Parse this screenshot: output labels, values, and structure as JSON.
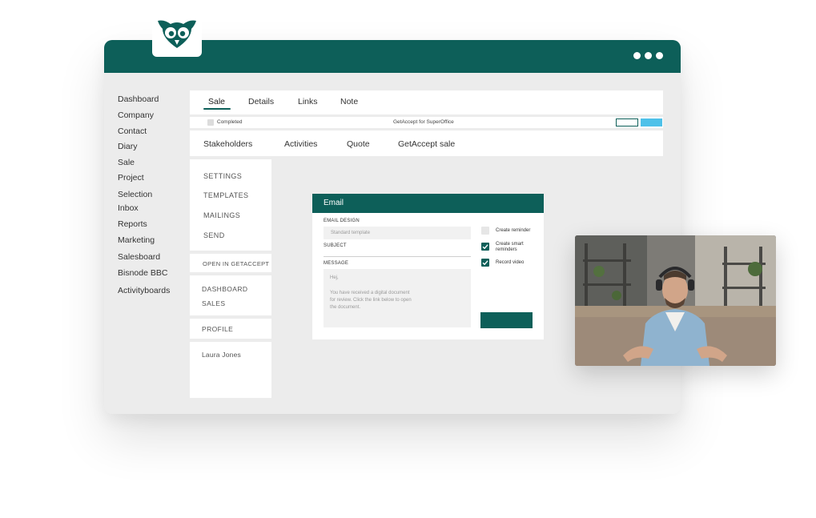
{
  "brand": {
    "primary": "#0d5f59",
    "accent": "#4ec1e9",
    "logo_icon": "owl-logo-icon"
  },
  "sidebar": {
    "items": [
      {
        "label": "Dashboard"
      },
      {
        "label": "Company"
      },
      {
        "label": "Contact"
      },
      {
        "label": "Diary"
      },
      {
        "label": "Sale"
      },
      {
        "label": "Project"
      },
      {
        "label": "Selection"
      },
      {
        "label": "Inbox"
      },
      {
        "label": "Reports"
      },
      {
        "label": "Marketing"
      },
      {
        "label": "Salesboard"
      },
      {
        "label": "Bisnode BBC"
      },
      {
        "label": "Activityboards"
      }
    ]
  },
  "top_tabs": {
    "tabs": [
      {
        "label": "Sale",
        "active": true
      },
      {
        "label": "Details"
      },
      {
        "label": "Links"
      },
      {
        "label": "Note"
      }
    ]
  },
  "status_bar": {
    "completed_label": "Completed",
    "center_text": "GetAccept for SuperOffice"
  },
  "sub_tabs": {
    "tabs": [
      {
        "label": "Stakeholders"
      },
      {
        "label": "Activities"
      },
      {
        "label": "Quote"
      },
      {
        "label": "GetAccept sale"
      }
    ]
  },
  "panel": {
    "settings": "SETTINGS",
    "templates": "TEMPLATES",
    "mailings": "MAILINGS",
    "send": "SEND",
    "open_in": "OPEN IN GETACCEPT",
    "dashboard": "DASHBOARD",
    "sales": "SALES",
    "profile": "PROFILE",
    "user": "Laura Jones"
  },
  "email": {
    "title": "Email",
    "design_label": "EMAIL DESIGN",
    "design_placeholder": "Standard template",
    "subject_label": "SUBJECT",
    "message_label": "MESSAGE",
    "message_lines": [
      "Hej,",
      "You have received a digital document",
      "for review. Click the link below to open",
      "the document."
    ],
    "options": [
      {
        "label_lines": [
          "Create reminder"
        ],
        "checked": false
      },
      {
        "label_lines": [
          "Create smart",
          "reminders"
        ],
        "checked": true
      },
      {
        "label_lines": [
          "Record video"
        ],
        "checked": true
      }
    ]
  }
}
